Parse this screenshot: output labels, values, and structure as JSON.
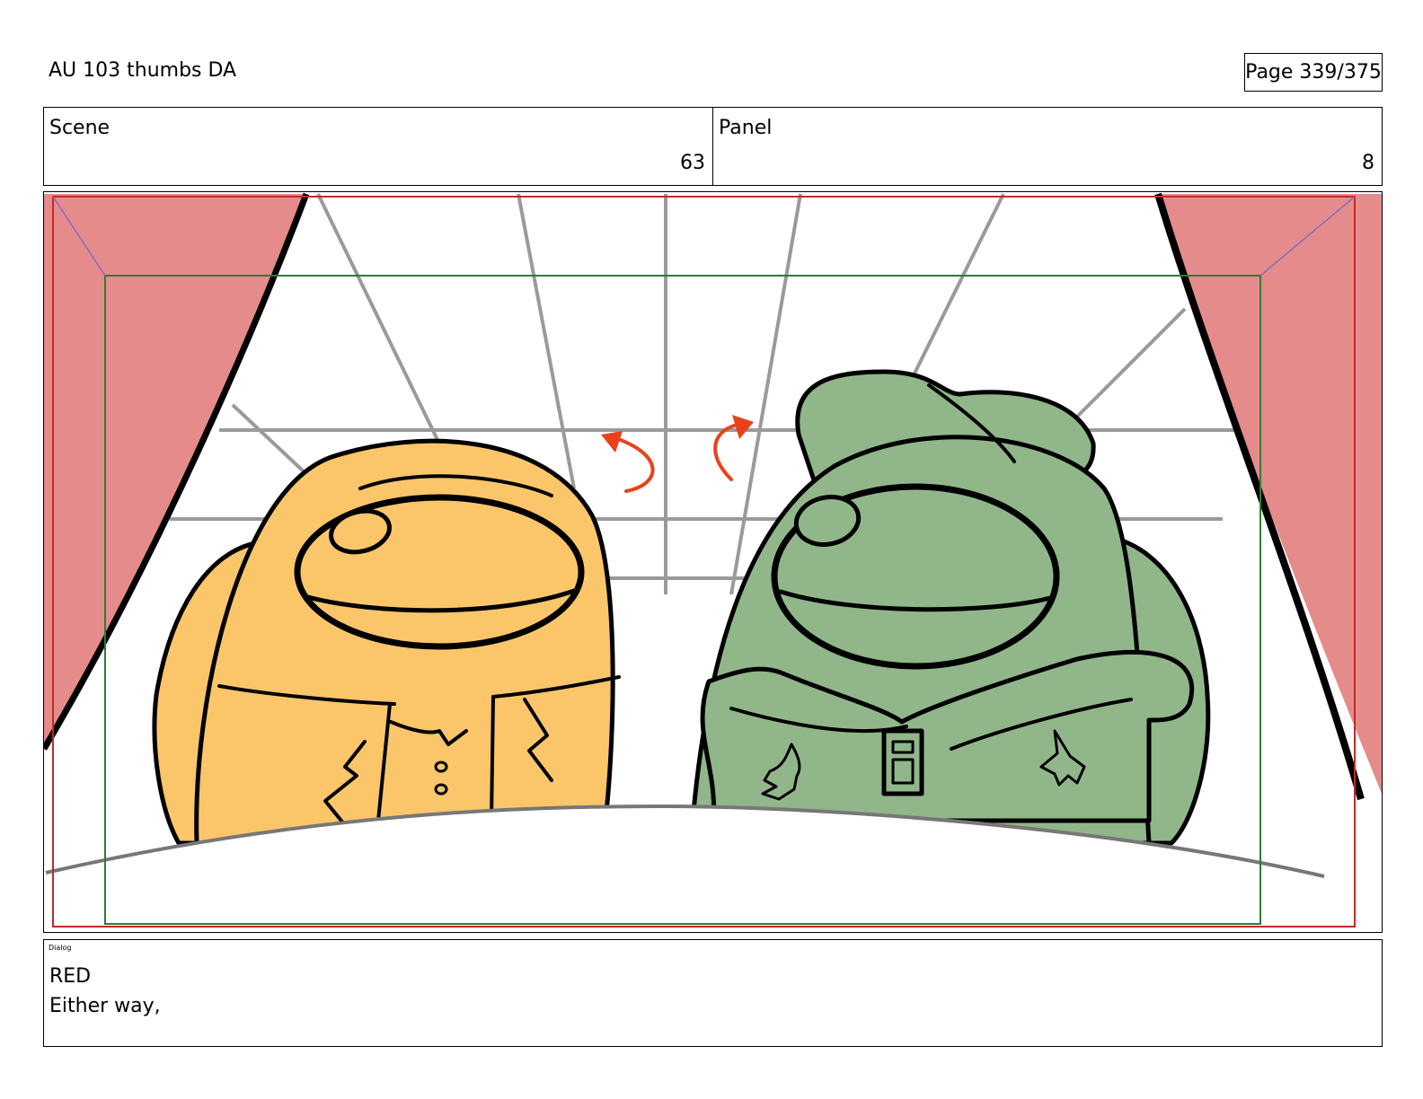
{
  "header": {
    "title": "AU 103 thumbs DA",
    "page": "Page 339/375"
  },
  "scene": {
    "label": "Scene",
    "value": "63"
  },
  "panel": {
    "label": "Panel",
    "value": "8"
  },
  "colors": {
    "curtain": "#e58b8c",
    "orange_crewmate": "#fbc66a",
    "green_crewmate": "#91b68a",
    "arrow": "#e8421d",
    "safe_frame": "#2e7d32",
    "outer_frame": "#c62828"
  },
  "artwork": {
    "characters": [
      "orange-crewmate",
      "green-crewmate"
    ],
    "icons": [
      "curtain-left",
      "curtain-right",
      "turn-arrow-left",
      "turn-arrow-right"
    ]
  },
  "dialog": {
    "label": "Dialog",
    "character": "RED",
    "line": "Either way,"
  }
}
